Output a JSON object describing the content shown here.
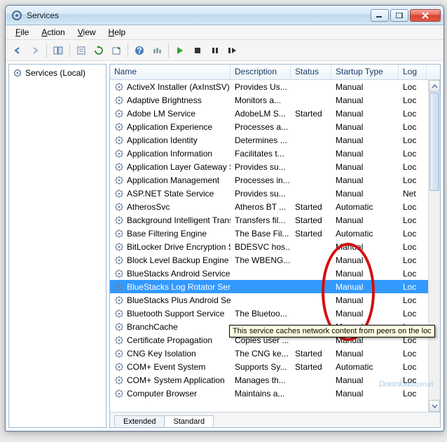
{
  "window": {
    "title": "Services"
  },
  "menu": {
    "file": "File",
    "action": "Action",
    "view": "View",
    "help": "Help"
  },
  "leftpane": {
    "root": "Services (Local)"
  },
  "columns": {
    "name": "Name",
    "description": "Description",
    "status": "Status",
    "startup": "Startup Type",
    "logon": "Log"
  },
  "tabs": {
    "extended": "Extended",
    "standard": "Standard"
  },
  "tooltip": "This service caches network content from peers on the loc",
  "watermark": {
    "main": "Download",
    "suffix": ".com.vn"
  },
  "services": [
    {
      "name": "ActiveX Installer (AxInstSV)",
      "desc": "Provides Us...",
      "status": "",
      "startup": "Manual",
      "log": "Loc"
    },
    {
      "name": "Adaptive Brightness",
      "desc": "Monitors a...",
      "status": "",
      "startup": "Manual",
      "log": "Loc"
    },
    {
      "name": "Adobe LM Service",
      "desc": "AdobeLM S...",
      "status": "Started",
      "startup": "Manual",
      "log": "Loc"
    },
    {
      "name": "Application Experience",
      "desc": "Processes a...",
      "status": "",
      "startup": "Manual",
      "log": "Loc"
    },
    {
      "name": "Application Identity",
      "desc": "Determines ...",
      "status": "",
      "startup": "Manual",
      "log": "Loc"
    },
    {
      "name": "Application Information",
      "desc": "Facilitates t...",
      "status": "",
      "startup": "Manual",
      "log": "Loc"
    },
    {
      "name": "Application Layer Gateway Ser...",
      "desc": "Provides su...",
      "status": "",
      "startup": "Manual",
      "log": "Loc"
    },
    {
      "name": "Application Management",
      "desc": "Processes in...",
      "status": "",
      "startup": "Manual",
      "log": "Loc"
    },
    {
      "name": "ASP.NET State Service",
      "desc": "Provides su...",
      "status": "",
      "startup": "Manual",
      "log": "Net"
    },
    {
      "name": "AtherosSvc",
      "desc": "Atheros BT ...",
      "status": "Started",
      "startup": "Automatic",
      "log": "Loc"
    },
    {
      "name": "Background Intelligent Transf...",
      "desc": "Transfers fil...",
      "status": "Started",
      "startup": "Manual",
      "log": "Loc"
    },
    {
      "name": "Base Filtering Engine",
      "desc": "The Base Fil...",
      "status": "Started",
      "startup": "Automatic",
      "log": "Loc"
    },
    {
      "name": "BitLocker Drive Encryption Ser...",
      "desc": "BDESVC hos...",
      "status": "",
      "startup": "Manual",
      "log": "Loc"
    },
    {
      "name": "Block Level Backup Engine Ser...",
      "desc": "The WBENG...",
      "status": "",
      "startup": "Manual",
      "log": "Loc"
    },
    {
      "name": "BlueStacks Android Service",
      "desc": "",
      "status": "",
      "startup": "Manual",
      "log": "Loc"
    },
    {
      "name": "BlueStacks Log Rotator Service",
      "desc": "",
      "status": "",
      "startup": "Manual",
      "log": "Loc",
      "selected": true
    },
    {
      "name": "BlueStacks Plus Android Servi...",
      "desc": "",
      "status": "",
      "startup": "Manual",
      "log": "Loc"
    },
    {
      "name": "Bluetooth Support Service",
      "desc": "The Bluetoo...",
      "status": "",
      "startup": "Manual",
      "log": "Loc"
    },
    {
      "name": "BranchCache",
      "desc": "",
      "status": "",
      "startup": "Manual",
      "log": "Loc"
    },
    {
      "name": "Certificate Propagation",
      "desc": "Copies user ...",
      "status": "",
      "startup": "Manual",
      "log": "Loc"
    },
    {
      "name": "CNG Key Isolation",
      "desc": "The CNG ke...",
      "status": "Started",
      "startup": "Manual",
      "log": "Loc"
    },
    {
      "name": "COM+ Event System",
      "desc": "Supports Sy...",
      "status": "Started",
      "startup": "Automatic",
      "log": "Loc"
    },
    {
      "name": "COM+ System Application",
      "desc": "Manages th...",
      "status": "",
      "startup": "Manual",
      "log": "Loc"
    },
    {
      "name": "Computer Browser",
      "desc": "Maintains a...",
      "status": "",
      "startup": "Manual",
      "log": "Loc"
    }
  ]
}
